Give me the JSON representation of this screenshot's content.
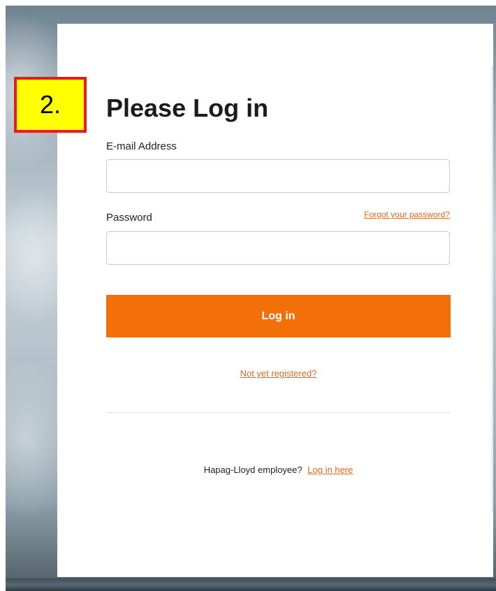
{
  "annotation": {
    "step_label": "2.",
    "border_color": "#e81a1a",
    "fill_color": "#ffff00"
  },
  "login": {
    "title": "Please Log in",
    "email_label": "E-mail Address",
    "email_value": "",
    "password_label": "Password",
    "password_value": "",
    "forgot_password_link": "Forgot your password?",
    "login_button_label": "Log in",
    "register_link": "Not yet registered?",
    "employee_prompt": "Hapag-Lloyd employee?",
    "employee_login_link": "Log in here"
  },
  "colors": {
    "accent": "#f46f07",
    "link": "#d66a1e",
    "title_text": "#1b1b1b"
  }
}
